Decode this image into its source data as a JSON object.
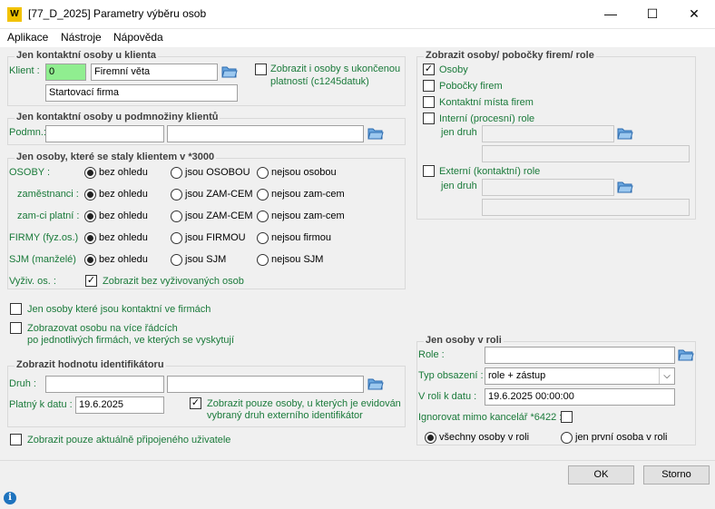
{
  "window": {
    "title": "[77_D_2025] Parametry výběru osob",
    "minimize": "—",
    "maximize": "☐",
    "close": "✕",
    "logo": "W"
  },
  "menu": [
    "Aplikace",
    "Nástroje",
    "Nápověda"
  ],
  "grpClient": {
    "title": "Jen kontaktní osoby u klienta",
    "label": "Klient :",
    "code": "0",
    "name": "Firemní věta",
    "start": "Startovací firma",
    "expiredCb": "Zobrazit i osoby s ukončenou",
    "expiredCb2": "platností (c1245datuk)"
  },
  "grpSubset": {
    "title": "Jen kontaktní osoby u podmnožiny klientů",
    "label": "Podmn.:"
  },
  "grpClients": {
    "title": "Jen osoby, které se staly klientem v *3000",
    "rows": [
      {
        "label": "OSOBY :",
        "a": "bez ohledu",
        "b": "jsou OSOBOU",
        "c": "nejsou osobou"
      },
      {
        "label": "zaměstnanci :",
        "a": "bez ohledu",
        "b": "jsou ZAM-CEM",
        "c": "nejsou zam-cem"
      },
      {
        "label": "zam-ci platní :",
        "a": "bez ohledu",
        "b": "jsou ZAM-CEM",
        "c": "nejsou zam-cem"
      },
      {
        "label": "FIRMY (fyz.os.)",
        "a": "bez ohledu",
        "b": "jsou FIRMOU",
        "c": "nejsou firmou"
      },
      {
        "label": "SJM (manželé)",
        "a": "bez ohledu",
        "b": "jsou SJM",
        "c": "nejsou SJM"
      }
    ],
    "dependentsLabel": "Vyživ. os. :",
    "dependentsCb": "Zobrazit bez vyživovaných osob"
  },
  "cbKontaktni": "Jen osoby které jsou kontaktní ve firmách",
  "cbMultiRow": "Zobrazovat osobu na více řádcích",
  "cbMultiRow2": "po jednotlivých firmách, ve kterých se vyskytují",
  "grpIdent": {
    "title": "Zobrazit hodnotu identifikátoru",
    "druhLabel": "Druh :",
    "dateLabel": "Platný k datu :",
    "date": "19.6.2025",
    "cb": "Zobrazit pouze osoby, u kterých je evidován",
    "cb2": "vybraný druh externího identifikátor"
  },
  "cbCurrentUser": "Zobrazit pouze aktuálně připojeného uživatele",
  "grpShow": {
    "title": "Zobrazit osoby/ pobočky firem/ role",
    "osoby": "Osoby",
    "pobocky": "Pobočky firem",
    "kontaktni": "Kontaktní místa firem",
    "interni": "Interní (procesní) role",
    "jenDruh1": "jen druh",
    "externi": "Externí (kontaktní) role",
    "jenDruh2": "jen druh"
  },
  "grpRole": {
    "title": "Jen osoby v roli",
    "roleLabel": "Role :",
    "typeLabel": "Typ obsazení :",
    "typeValue": "role + zástup",
    "dateLabel": "V roli k datu :",
    "dateValue": "19.6.2025 00:00:00",
    "ignoreLabel": "Ignorovat mimo kancelář *6422 :",
    "allPersons": "všechny osoby v roli",
    "firstPerson": "jen první osoba v roli"
  },
  "buttons": {
    "ok": "OK",
    "cancel": "Storno"
  },
  "info": "i"
}
